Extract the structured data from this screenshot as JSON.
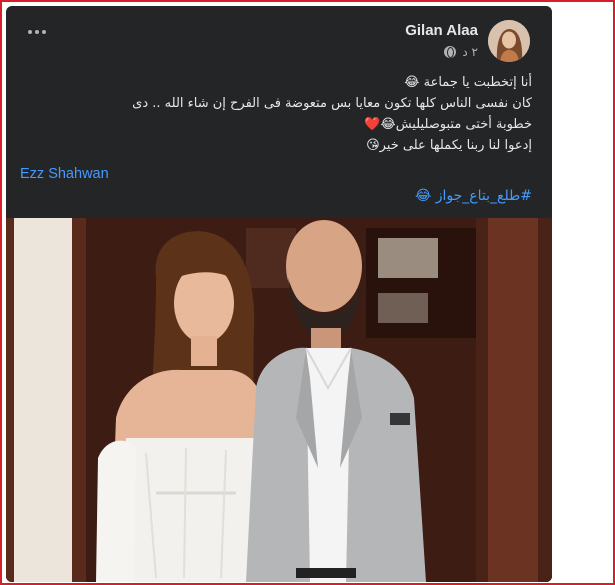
{
  "post": {
    "author": "Gilan Alaa",
    "time": "٢ د",
    "lines": [
      "أنا إتخطبت يا جماعة 😂",
      "كان نفسى الناس كلها تكون معايا بس متعوضة فى الفرح إن شاء الله .. دى",
      "خطوبة أختى متبوصليليش😂❤️",
      "إدعوا لنا ربنا يكملها على خير😘"
    ],
    "mention": "Ezz Shahwan",
    "hashtag": "#طلع_بتاع_جواز 😂",
    "icons": {
      "more": "more-horizontal-icon",
      "privacy": "globe-icon"
    }
  },
  "colors": {
    "card_bg": "#242526",
    "text": "#e4e6eb",
    "muted": "#b0b3b8",
    "link": "#4599ff",
    "frame_border": "#d51f2a"
  }
}
